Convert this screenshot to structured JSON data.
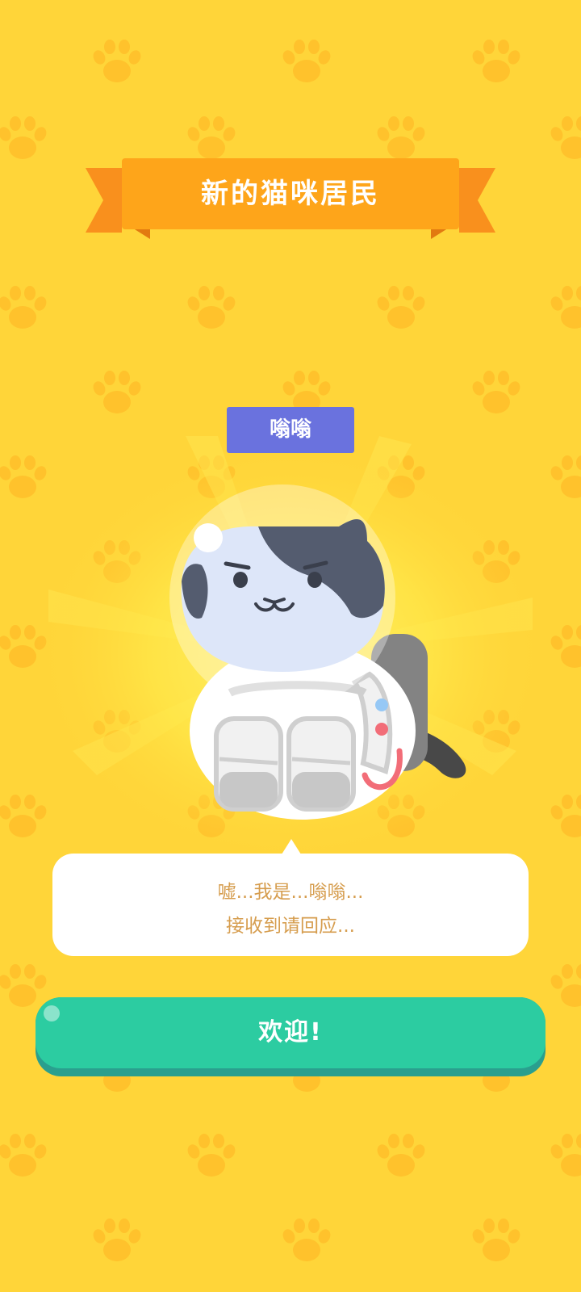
{
  "banner": {
    "title": "新的猫咪居民"
  },
  "cat": {
    "name": "嗡嗡"
  },
  "dialog": {
    "line1": "嘘...我是...嗡嗡...",
    "line2": "接收到请回应..."
  },
  "actions": {
    "welcome_label": "欢迎!"
  },
  "colors": {
    "background": "#FFD539",
    "paw": "#FFC22C",
    "ribbon": "#FEA51A",
    "name_tag": "#6A72DE",
    "bubble_text": "#D69D4E",
    "button": "#2CCCA1"
  }
}
